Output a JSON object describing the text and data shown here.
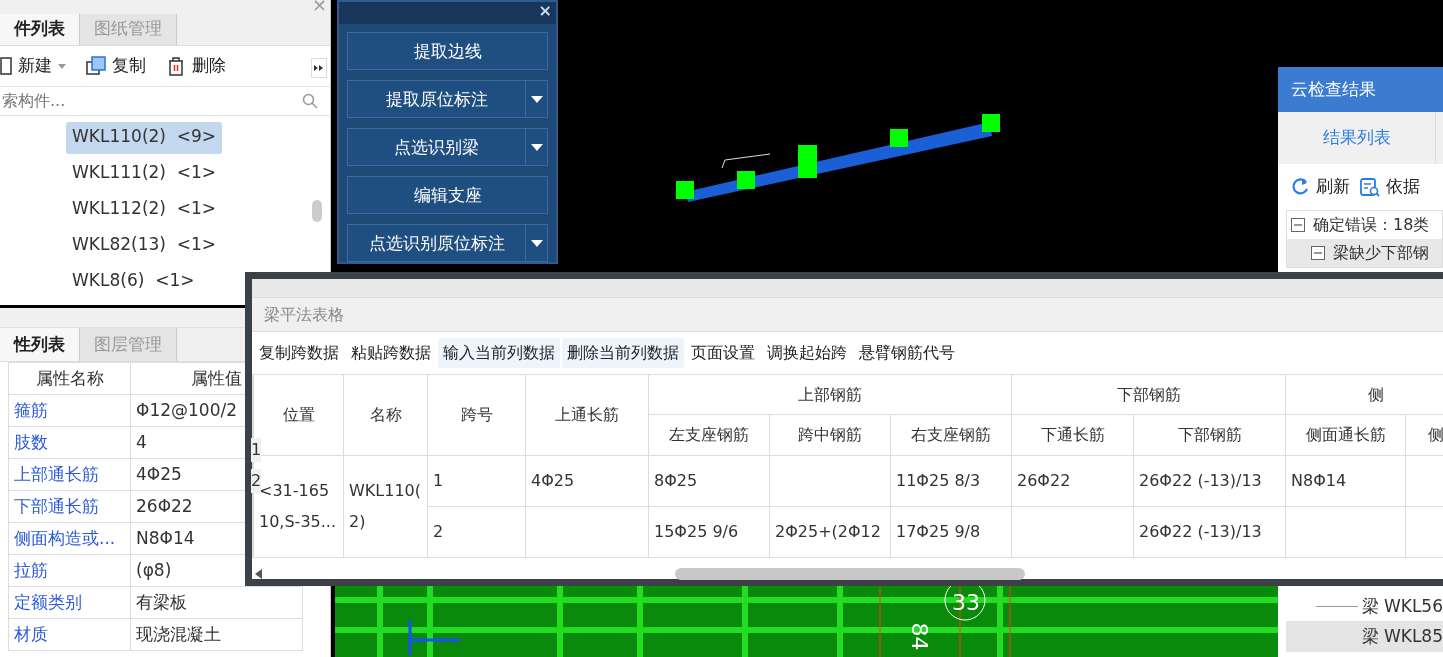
{
  "component_panel": {
    "close": "×",
    "tabs": [
      {
        "label": "件列表",
        "selected": true
      },
      {
        "label": "图纸管理",
        "selected": false
      }
    ],
    "toolbar": [
      {
        "kind": "new",
        "label": "新建"
      },
      {
        "kind": "copy",
        "label": "复制"
      },
      {
        "kind": "delete",
        "label": "删除"
      }
    ],
    "search": {
      "placeholder": "索构件..."
    },
    "components": [
      {
        "name": "WKL110(2)",
        "count": "<9>",
        "selected": true
      },
      {
        "name": "WKL111(2)",
        "count": "<1>",
        "selected": false
      },
      {
        "name": "WKL112(2)",
        "count": "<1>",
        "selected": false
      },
      {
        "name": "WKL82(13)",
        "count": "<1>",
        "selected": false
      },
      {
        "name": "WKL8(6)",
        "count": "<1>",
        "selected": false
      }
    ]
  },
  "property_panel": {
    "tabs": [
      {
        "label": "性列表",
        "selected": true
      },
      {
        "label": "图层管理",
        "selected": false
      }
    ],
    "columns": [
      "属性名称",
      "属性值"
    ],
    "rows": [
      {
        "name": "箍筋",
        "value": "Φ12@100/2"
      },
      {
        "name": "肢数",
        "value": "4"
      },
      {
        "name": "上部通长筋",
        "value": "4Φ25"
      },
      {
        "name": "下部通长筋",
        "value": "26Φ22"
      },
      {
        "name": "侧面构造或...",
        "value": "N8Φ14"
      },
      {
        "name": "拉筋",
        "value": "(φ8)"
      },
      {
        "name": "定额类别",
        "value": "有梁板"
      },
      {
        "name": "材质",
        "value": "现浇混凝土"
      }
    ]
  },
  "tool_panel": {
    "close": "×",
    "buttons": [
      {
        "label": "提取边线",
        "dropdown": false
      },
      {
        "label": "提取原位标注",
        "dropdown": true
      },
      {
        "label": "点选识别梁",
        "dropdown": true
      },
      {
        "label": "编辑支座",
        "dropdown": false
      },
      {
        "label": "点选识别原位标注",
        "dropdown": true
      }
    ]
  },
  "cloud_check": {
    "title": "云检查结果",
    "tabs": [
      {
        "label": "结果列表",
        "selected": true
      }
    ],
    "toolbar": [
      {
        "kind": "refresh",
        "label": "刷新"
      },
      {
        "kind": "basis",
        "label": "依据"
      }
    ],
    "tree": [
      {
        "label": "确定错误：18类",
        "expanded": true,
        "children": [
          {
            "label": "梁缺少下部钢",
            "expanded": true
          }
        ]
      }
    ],
    "items": [
      {
        "label": "梁 WKL56",
        "selected": false
      },
      {
        "label": "梁 WKL85",
        "selected": true
      }
    ]
  },
  "beam_table": {
    "title": "梁平法表格",
    "toolbar": [
      {
        "label": "复制跨数据",
        "highlighted": false
      },
      {
        "label": "粘贴跨数据",
        "highlighted": false
      },
      {
        "label": "输入当前列数据",
        "highlighted": true
      },
      {
        "label": "删除当前列数据",
        "highlighted": true
      },
      {
        "label": "页面设置",
        "highlighted": false
      },
      {
        "label": "调换起始跨",
        "highlighted": false
      },
      {
        "label": "悬臂钢筋代号",
        "highlighted": false
      }
    ],
    "columns": [
      {
        "label": "位置"
      },
      {
        "label": "名称"
      },
      {
        "label": "跨号"
      },
      {
        "label": "上通长筋"
      },
      {
        "label": "上部钢筋",
        "colspan": 3,
        "children": [
          "左支座钢筋",
          "跨中钢筋",
          "右支座钢筋"
        ]
      },
      {
        "label": "下部钢筋",
        "colspan": 2,
        "children": [
          "下通长筋",
          "下部钢筋"
        ]
      },
      {
        "label": "侧",
        "colspan": 2,
        "children": [
          "侧面通长筋",
          "侧"
        ]
      }
    ],
    "rows": [
      {
        "number": "1",
        "cells": [
          {
            "text": "<31-165\n10,S-35...",
            "rowspan": 2
          },
          {
            "text": "WKL110(\n2)",
            "rowspan": 2
          },
          "1",
          "4Φ25",
          "8Φ25",
          null,
          "11Φ25 8/3",
          "26Φ22",
          "26Φ22 (-13)/13",
          "N8Φ14",
          null
        ]
      },
      {
        "number": "2",
        "cells": [
          "2",
          null,
          "15Φ25 9/6",
          "2Φ25+(2Φ12",
          "17Φ25 9/8",
          null,
          "26Φ22 (-13)/13",
          null,
          null
        ]
      }
    ]
  },
  "canvas": {
    "labels": [
      "33",
      "84"
    ]
  }
}
